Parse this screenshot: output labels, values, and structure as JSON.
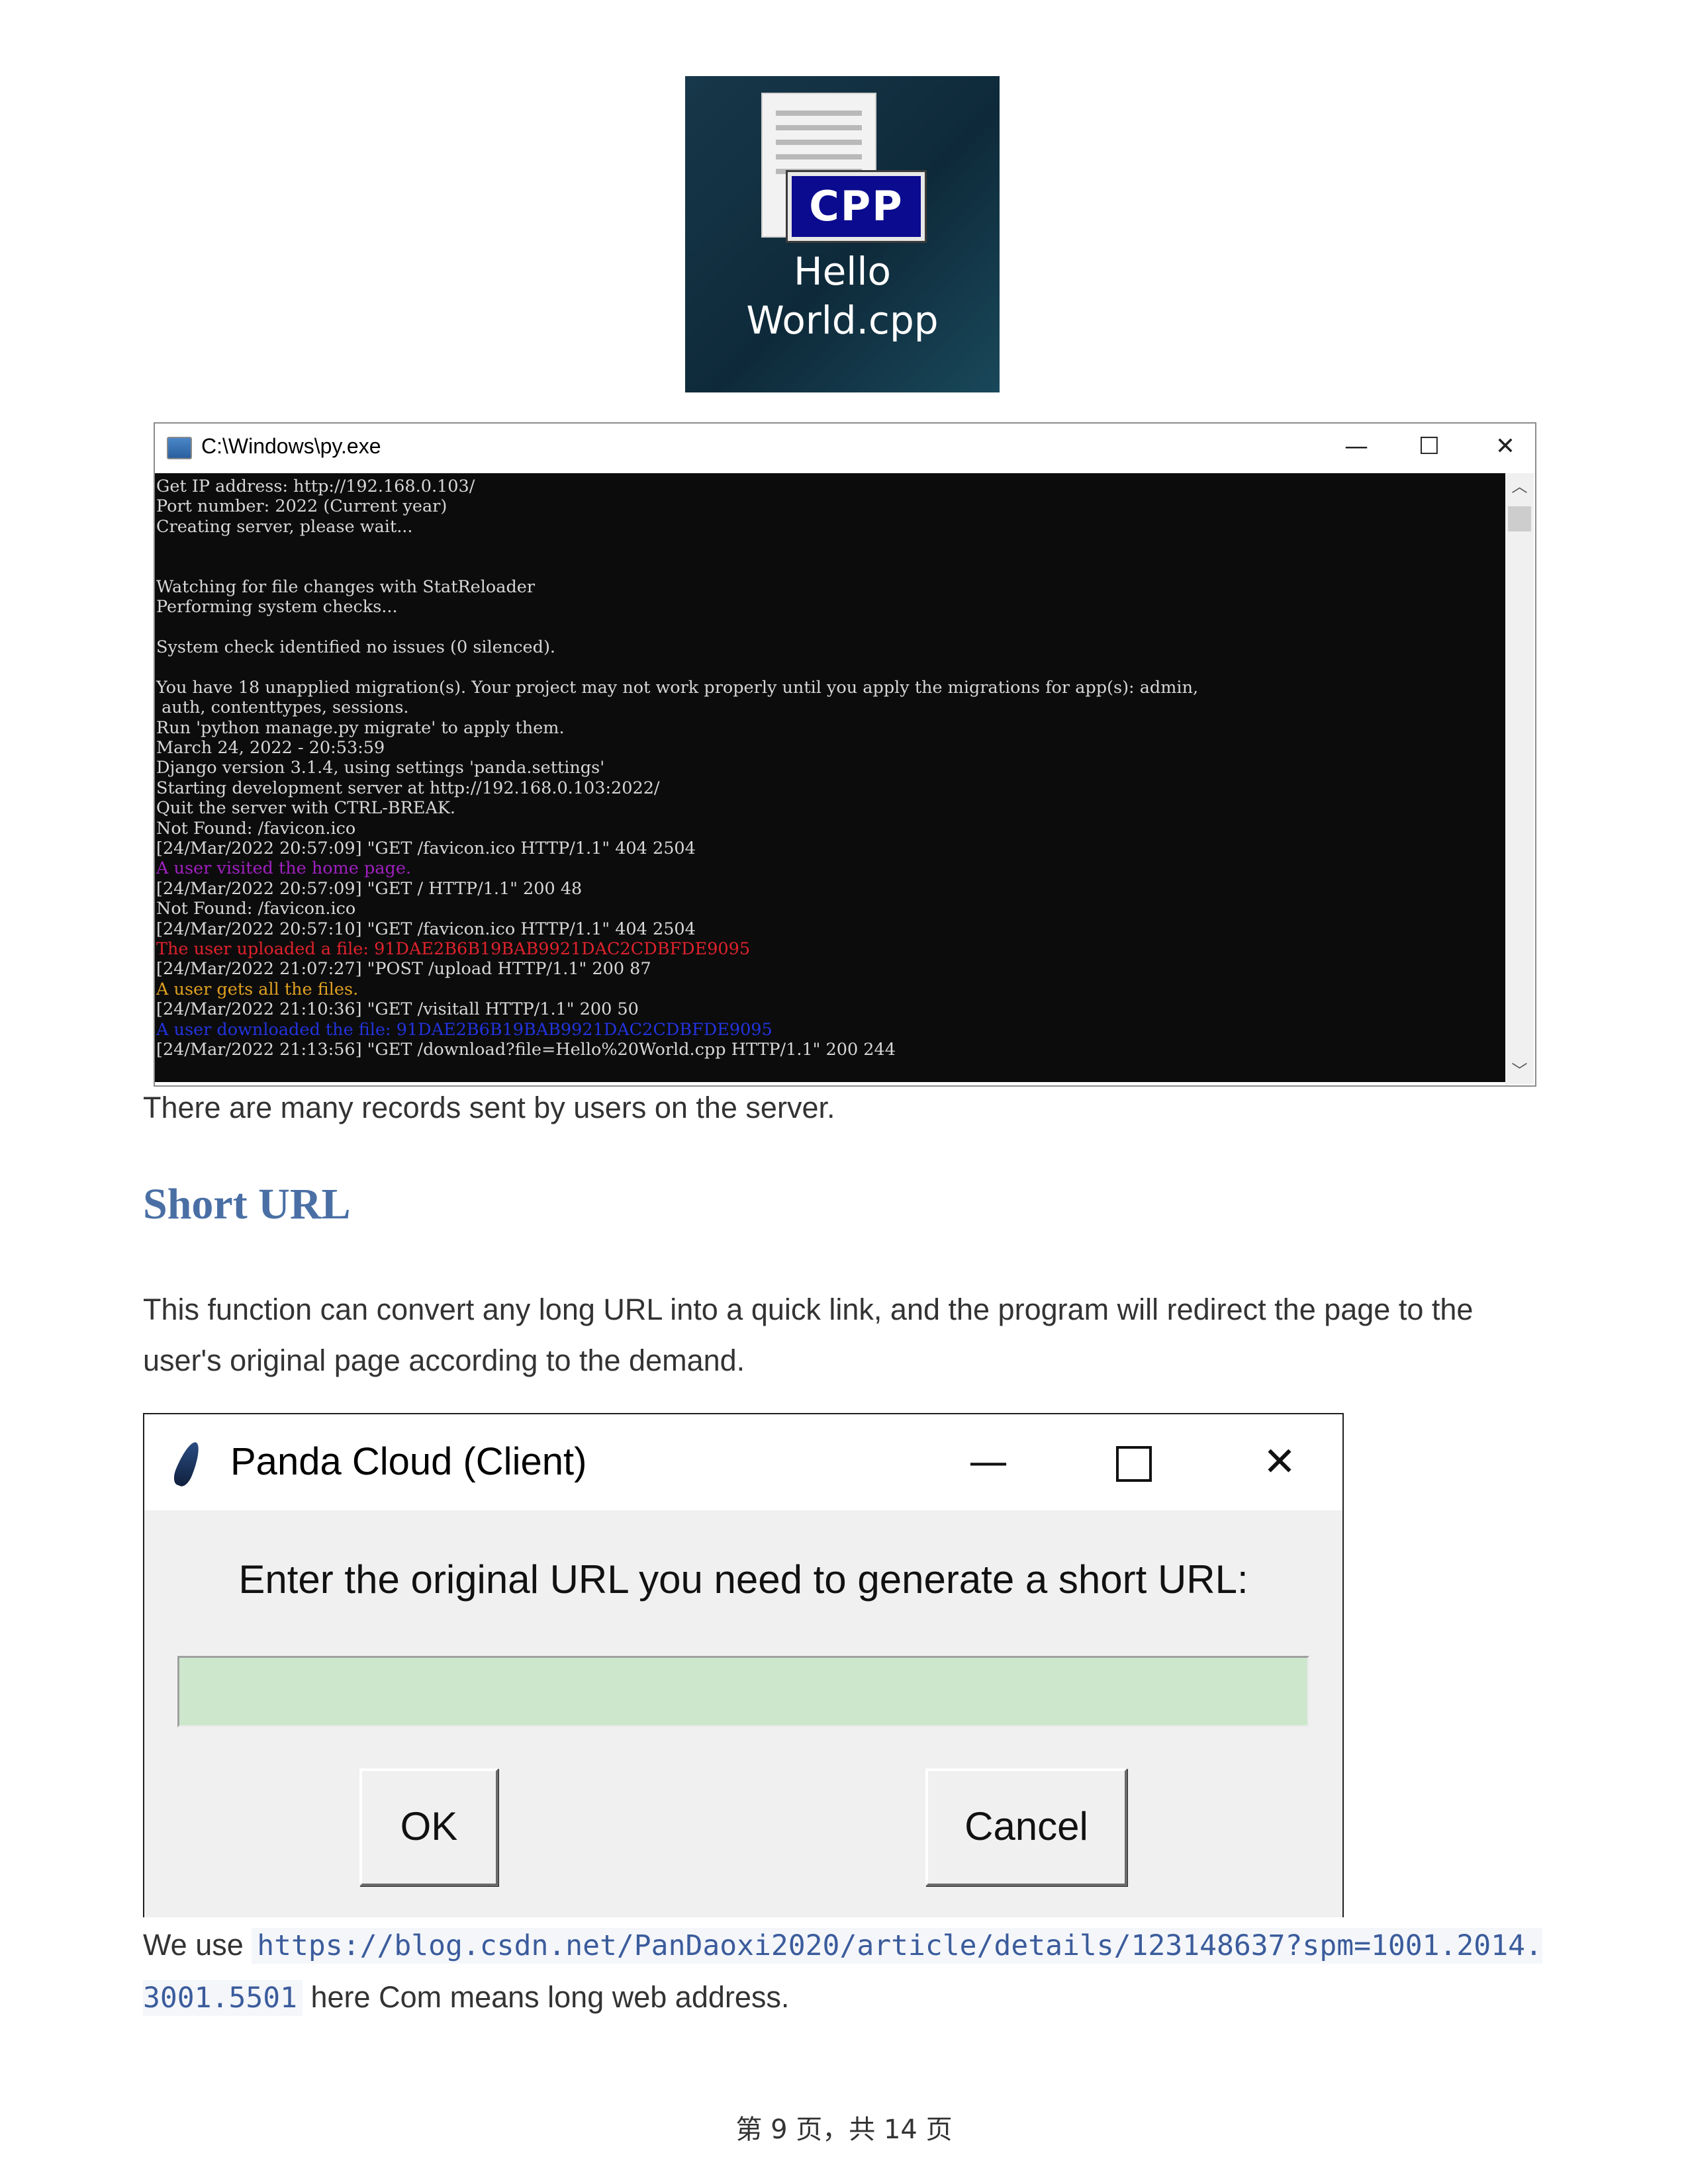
{
  "desktop_icon": {
    "badge": "CPP",
    "label_line1": "Hello",
    "label_line2": "World.cpp"
  },
  "console": {
    "title": "C:\\Windows\\py.exe",
    "controls": {
      "minimize": "—",
      "maximize": "☐",
      "close": "✕"
    },
    "lines": [
      {
        "text": "Get IP address: http://192.168.0.103/",
        "color": "#d7d7d7"
      },
      {
        "text": "Port number: 2022 (Current year)",
        "color": "#d7d7d7"
      },
      {
        "text": "Creating server, please wait...",
        "color": "#d7d7d7"
      },
      {
        "text": "",
        "color": "#d7d7d7"
      },
      {
        "text": "",
        "color": "#d7d7d7"
      },
      {
        "text": "Watching for file changes with StatReloader",
        "color": "#d7d7d7"
      },
      {
        "text": "Performing system checks...",
        "color": "#d7d7d7"
      },
      {
        "text": "",
        "color": "#d7d7d7"
      },
      {
        "text": "System check identified no issues (0 silenced).",
        "color": "#d7d7d7"
      },
      {
        "text": "",
        "color": "#d7d7d7"
      },
      {
        "text": "You have 18 unapplied migration(s). Your project may not work properly until you apply the migrations for app(s): admin,",
        "color": "#d7d7d7"
      },
      {
        "text": " auth, contenttypes, sessions.",
        "color": "#d7d7d7"
      },
      {
        "text": "Run 'python manage.py migrate' to apply them.",
        "color": "#d7d7d7"
      },
      {
        "text": "March 24, 2022 - 20:53:59",
        "color": "#d7d7d7"
      },
      {
        "text": "Django version 3.1.4, using settings 'panda.settings'",
        "color": "#d7d7d7"
      },
      {
        "text": "Starting development server at http://192.168.0.103:2022/",
        "color": "#d7d7d7"
      },
      {
        "text": "Quit the server with CTRL-BREAK.",
        "color": "#d7d7d7"
      },
      {
        "text": "Not Found: /favicon.ico",
        "color": "#d7d7d7"
      },
      {
        "text": "[24/Mar/2022 20:57:09] \"GET /favicon.ico HTTP/1.1\" 404 2504",
        "color": "#d7d7d7"
      },
      {
        "text": "A user visited the home page.",
        "color": "#a020c0"
      },
      {
        "text": "[24/Mar/2022 20:57:09] \"GET / HTTP/1.1\" 200 48",
        "color": "#d7d7d7"
      },
      {
        "text": "Not Found: /favicon.ico",
        "color": "#d7d7d7"
      },
      {
        "text": "[24/Mar/2022 20:57:10] \"GET /favicon.ico HTTP/1.1\" 404 2504",
        "color": "#d7d7d7"
      },
      {
        "text": "The user uploaded a file: 91DAE2B6B19BAB9921DAC2CDBFDE9095",
        "color": "#e0222c"
      },
      {
        "text": "[24/Mar/2022 21:07:27] \"POST /upload HTTP/1.1\" 200 87",
        "color": "#d7d7d7"
      },
      {
        "text": "A user gets all the files.",
        "color": "#e0a020"
      },
      {
        "text": "[24/Mar/2022 21:10:36] \"GET /visitall HTTP/1.1\" 200 50",
        "color": "#d7d7d7"
      },
      {
        "text": "A user downloaded the file: 91DAE2B6B19BAB9921DAC2CDBFDE9095",
        "color": "#2233dd"
      },
      {
        "text": "[24/Mar/2022 21:13:56] \"GET /download?file=Hello%20World.cpp HTTP/1.1\" 200 244",
        "color": "#d7d7d7"
      }
    ]
  },
  "caption": "There are many records sent by users on the server.",
  "section_heading": "Short URL",
  "paragraph": "This function can convert any long URL into a quick link, and the program will redirect the page to the user's original page according to the demand.",
  "dialog": {
    "title": "Panda Cloud (Client)",
    "controls": {
      "minimize": "—",
      "close": "✕"
    },
    "prompt": "Enter the original URL you need to generate a short URL:",
    "input_value": "",
    "ok_label": "OK",
    "cancel_label": "Cancel",
    "input_color": "#cde7cd"
  },
  "final_paragraph": {
    "before": "We use ",
    "url": "https://blog.csdn.net/PanDaoxi2020/article/details/123148637?spm=1001.2014.3001.5501",
    "after": " here Com means long web address."
  },
  "footer": "第 9 页，共 14 页"
}
